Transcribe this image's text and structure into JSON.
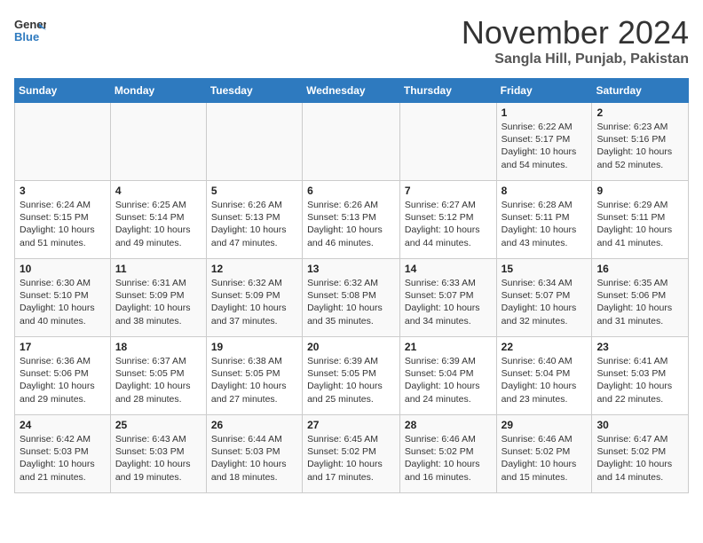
{
  "header": {
    "logo_line1": "General",
    "logo_line2": "Blue",
    "month": "November 2024",
    "location": "Sangla Hill, Punjab, Pakistan"
  },
  "weekdays": [
    "Sunday",
    "Monday",
    "Tuesday",
    "Wednesday",
    "Thursday",
    "Friday",
    "Saturday"
  ],
  "weeks": [
    [
      {
        "day": "",
        "info": ""
      },
      {
        "day": "",
        "info": ""
      },
      {
        "day": "",
        "info": ""
      },
      {
        "day": "",
        "info": ""
      },
      {
        "day": "",
        "info": ""
      },
      {
        "day": "1",
        "info": "Sunrise: 6:22 AM\nSunset: 5:17 PM\nDaylight: 10 hours\nand 54 minutes."
      },
      {
        "day": "2",
        "info": "Sunrise: 6:23 AM\nSunset: 5:16 PM\nDaylight: 10 hours\nand 52 minutes."
      }
    ],
    [
      {
        "day": "3",
        "info": "Sunrise: 6:24 AM\nSunset: 5:15 PM\nDaylight: 10 hours\nand 51 minutes."
      },
      {
        "day": "4",
        "info": "Sunrise: 6:25 AM\nSunset: 5:14 PM\nDaylight: 10 hours\nand 49 minutes."
      },
      {
        "day": "5",
        "info": "Sunrise: 6:26 AM\nSunset: 5:13 PM\nDaylight: 10 hours\nand 47 minutes."
      },
      {
        "day": "6",
        "info": "Sunrise: 6:26 AM\nSunset: 5:13 PM\nDaylight: 10 hours\nand 46 minutes."
      },
      {
        "day": "7",
        "info": "Sunrise: 6:27 AM\nSunset: 5:12 PM\nDaylight: 10 hours\nand 44 minutes."
      },
      {
        "day": "8",
        "info": "Sunrise: 6:28 AM\nSunset: 5:11 PM\nDaylight: 10 hours\nand 43 minutes."
      },
      {
        "day": "9",
        "info": "Sunrise: 6:29 AM\nSunset: 5:11 PM\nDaylight: 10 hours\nand 41 minutes."
      }
    ],
    [
      {
        "day": "10",
        "info": "Sunrise: 6:30 AM\nSunset: 5:10 PM\nDaylight: 10 hours\nand 40 minutes."
      },
      {
        "day": "11",
        "info": "Sunrise: 6:31 AM\nSunset: 5:09 PM\nDaylight: 10 hours\nand 38 minutes."
      },
      {
        "day": "12",
        "info": "Sunrise: 6:32 AM\nSunset: 5:09 PM\nDaylight: 10 hours\nand 37 minutes."
      },
      {
        "day": "13",
        "info": "Sunrise: 6:32 AM\nSunset: 5:08 PM\nDaylight: 10 hours\nand 35 minutes."
      },
      {
        "day": "14",
        "info": "Sunrise: 6:33 AM\nSunset: 5:07 PM\nDaylight: 10 hours\nand 34 minutes."
      },
      {
        "day": "15",
        "info": "Sunrise: 6:34 AM\nSunset: 5:07 PM\nDaylight: 10 hours\nand 32 minutes."
      },
      {
        "day": "16",
        "info": "Sunrise: 6:35 AM\nSunset: 5:06 PM\nDaylight: 10 hours\nand 31 minutes."
      }
    ],
    [
      {
        "day": "17",
        "info": "Sunrise: 6:36 AM\nSunset: 5:06 PM\nDaylight: 10 hours\nand 29 minutes."
      },
      {
        "day": "18",
        "info": "Sunrise: 6:37 AM\nSunset: 5:05 PM\nDaylight: 10 hours\nand 28 minutes."
      },
      {
        "day": "19",
        "info": "Sunrise: 6:38 AM\nSunset: 5:05 PM\nDaylight: 10 hours\nand 27 minutes."
      },
      {
        "day": "20",
        "info": "Sunrise: 6:39 AM\nSunset: 5:05 PM\nDaylight: 10 hours\nand 25 minutes."
      },
      {
        "day": "21",
        "info": "Sunrise: 6:39 AM\nSunset: 5:04 PM\nDaylight: 10 hours\nand 24 minutes."
      },
      {
        "day": "22",
        "info": "Sunrise: 6:40 AM\nSunset: 5:04 PM\nDaylight: 10 hours\nand 23 minutes."
      },
      {
        "day": "23",
        "info": "Sunrise: 6:41 AM\nSunset: 5:03 PM\nDaylight: 10 hours\nand 22 minutes."
      }
    ],
    [
      {
        "day": "24",
        "info": "Sunrise: 6:42 AM\nSunset: 5:03 PM\nDaylight: 10 hours\nand 21 minutes."
      },
      {
        "day": "25",
        "info": "Sunrise: 6:43 AM\nSunset: 5:03 PM\nDaylight: 10 hours\nand 19 minutes."
      },
      {
        "day": "26",
        "info": "Sunrise: 6:44 AM\nSunset: 5:03 PM\nDaylight: 10 hours\nand 18 minutes."
      },
      {
        "day": "27",
        "info": "Sunrise: 6:45 AM\nSunset: 5:02 PM\nDaylight: 10 hours\nand 17 minutes."
      },
      {
        "day": "28",
        "info": "Sunrise: 6:46 AM\nSunset: 5:02 PM\nDaylight: 10 hours\nand 16 minutes."
      },
      {
        "day": "29",
        "info": "Sunrise: 6:46 AM\nSunset: 5:02 PM\nDaylight: 10 hours\nand 15 minutes."
      },
      {
        "day": "30",
        "info": "Sunrise: 6:47 AM\nSunset: 5:02 PM\nDaylight: 10 hours\nand 14 minutes."
      }
    ]
  ]
}
